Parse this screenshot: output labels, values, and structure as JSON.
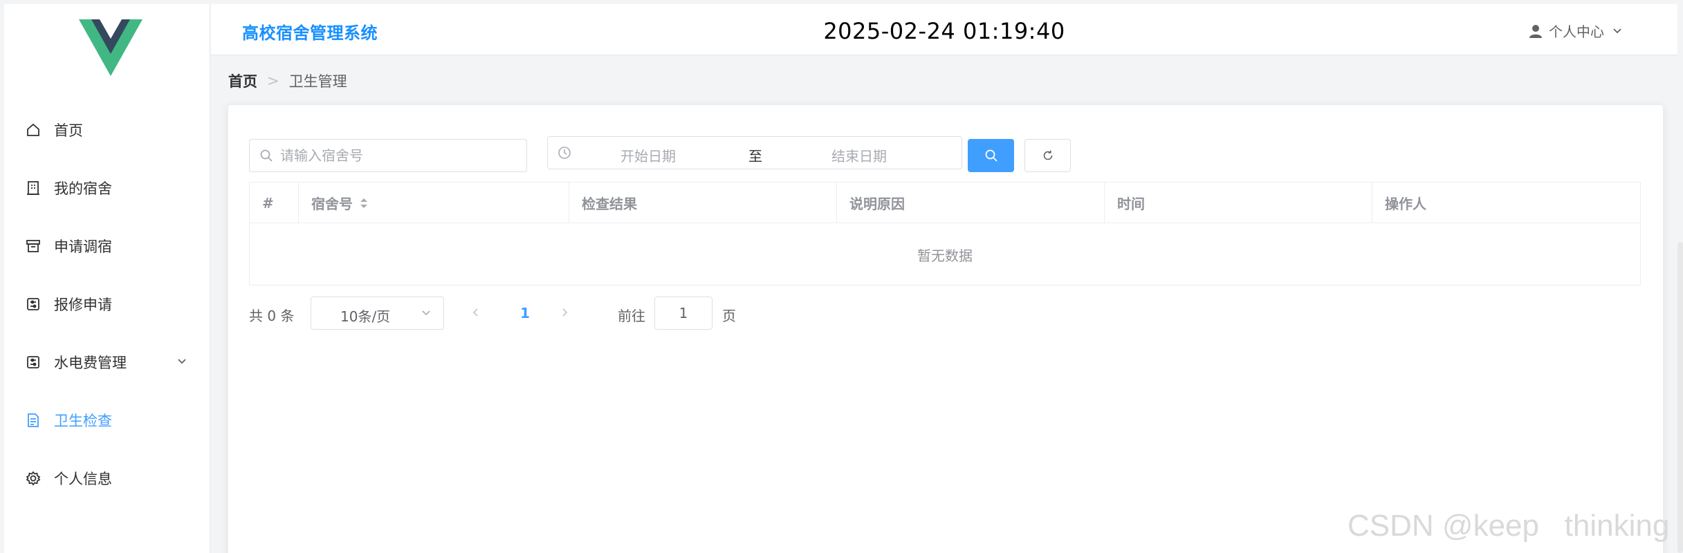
{
  "header": {
    "app_title": "高校宿舍管理系统",
    "datetime": "2025-02-24 01:19:40",
    "user_menu_label": "个人中心",
    "user_icon": "user-icon"
  },
  "sidebar": {
    "logo": "vue-logo",
    "logo_colors": {
      "outer": "#41b883",
      "inner": "#34495e"
    },
    "items": [
      {
        "label": "首页",
        "icon": "home-icon",
        "active": false
      },
      {
        "label": "我的宿舍",
        "icon": "building-icon",
        "active": false
      },
      {
        "label": "申请调宿",
        "icon": "archive-icon",
        "active": false
      },
      {
        "label": "报修申请",
        "icon": "tool-icon",
        "active": false
      },
      {
        "label": "水电费管理",
        "icon": "meter-icon",
        "active": false,
        "expandable": true
      },
      {
        "label": "卫生检查",
        "icon": "document-icon",
        "active": true
      },
      {
        "label": "个人信息",
        "icon": "gear-icon",
        "active": false
      }
    ]
  },
  "breadcrumb": {
    "home": "首页",
    "separator": ">",
    "current": "卫生管理"
  },
  "filters": {
    "dorm_placeholder": "请输入宿舍号",
    "date_start_placeholder": "开始日期",
    "date_separator": "至",
    "date_end_placeholder": "结束日期"
  },
  "table": {
    "columns": [
      "#",
      "宿舍号",
      "检查结果",
      "说明原因",
      "时间",
      "操作人"
    ],
    "rows": [],
    "empty_text": "暂无数据"
  },
  "pagination": {
    "total_text": "共 0 条",
    "page_size": "10条/页",
    "current_page": "1",
    "goto_label": "前往",
    "goto_value": "1",
    "page_suffix": "页"
  },
  "watermark": "CSDN @keep   thinking",
  "colors": {
    "primary": "#409eff",
    "title": "#1890ff",
    "border": "#dcdfe6",
    "muted": "#a8abb2"
  }
}
